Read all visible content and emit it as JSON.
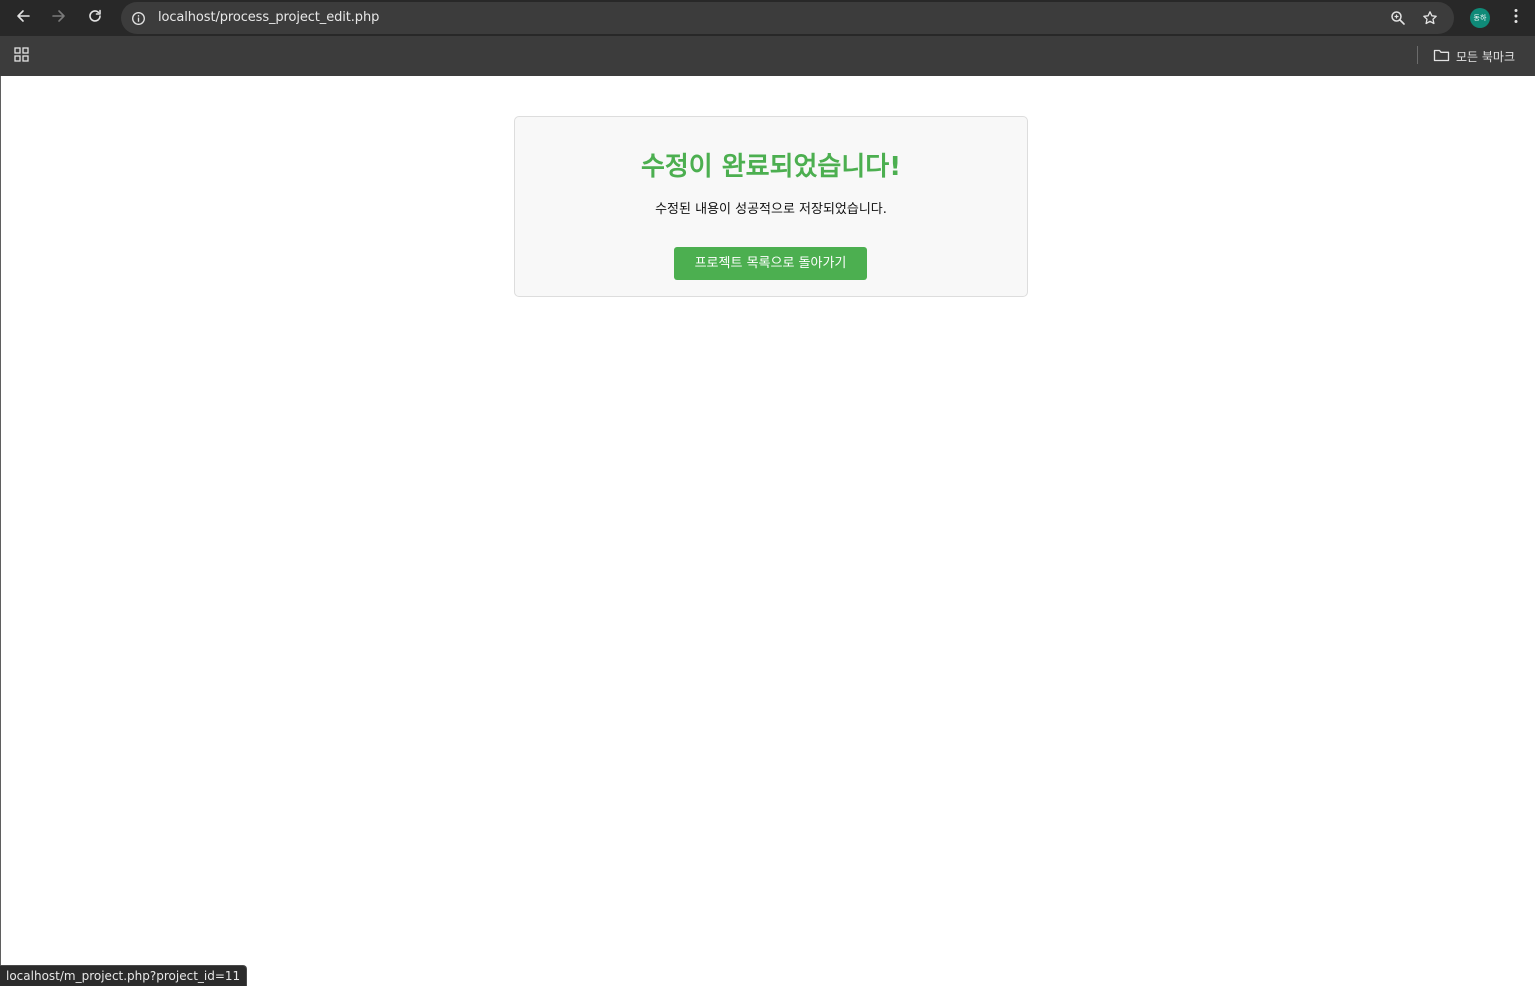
{
  "browser": {
    "url": "localhost/process_project_edit.php",
    "profile_initials": "동하",
    "bookmarks_label": "모든 북마크"
  },
  "page": {
    "title": "수정이 완료되었습니다!",
    "message": "수정된 내용이 성공적으로 저장되었습니다.",
    "back_button_label": "프로젝트 목록으로 돌아가기"
  },
  "status_bar": {
    "link_url": "localhost/m_project.php?project_id=11"
  },
  "colors": {
    "success_green": "#4caf50",
    "card_background": "#f8f8f8",
    "card_border": "#dddddd",
    "profile_avatar": "#0f8a78",
    "toolbar_dark": "#282828",
    "bookmark_bar": "#3c3c3c"
  },
  "icons": {
    "back": "arrow-left-icon",
    "forward": "arrow-right-icon",
    "reload": "reload-icon",
    "site_info": "info-icon",
    "zoom": "zoom-icon",
    "bookmark_star": "star-icon",
    "menu": "kebab-menu-icon",
    "apps": "apps-grid-icon",
    "folder": "folder-icon"
  }
}
